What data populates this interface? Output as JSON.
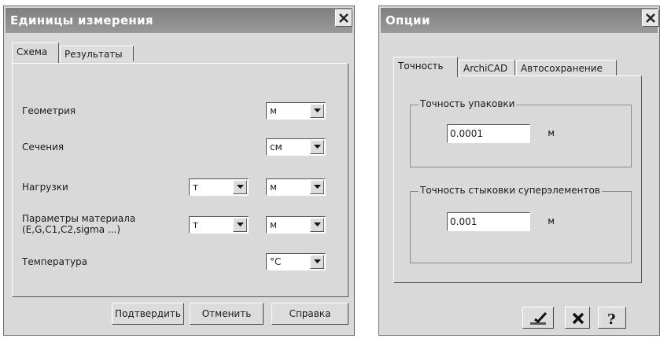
{
  "units_dialog": {
    "title": "Единицы измерения",
    "tabs": [
      "Схема",
      "Результаты"
    ],
    "rows": [
      {
        "label": "Геометрия",
        "combo2": "м"
      },
      {
        "label": "Сечения",
        "combo2": "см"
      },
      {
        "label": "Нагрузки",
        "combo1": "т",
        "combo2": "м"
      },
      {
        "label": "Параметры материала\n(E,G,C1,C2,sigma ...)",
        "combo1": "т",
        "combo2": "м"
      },
      {
        "label": "Температура",
        "combo2": "°C"
      }
    ],
    "buttons": {
      "confirm": "Подтвердить",
      "cancel": "Отменить",
      "help": "Справка"
    }
  },
  "options_dialog": {
    "title": "Опции",
    "tabs": [
      "Точность",
      "ArchiCAD",
      "Автосохранение"
    ],
    "groups": [
      {
        "legend": "Точность упаковки",
        "value": "0.0001",
        "unit": "м"
      },
      {
        "legend": "Точность стыковки суперэлементов",
        "value": "0.001",
        "unit": "м"
      }
    ]
  }
}
